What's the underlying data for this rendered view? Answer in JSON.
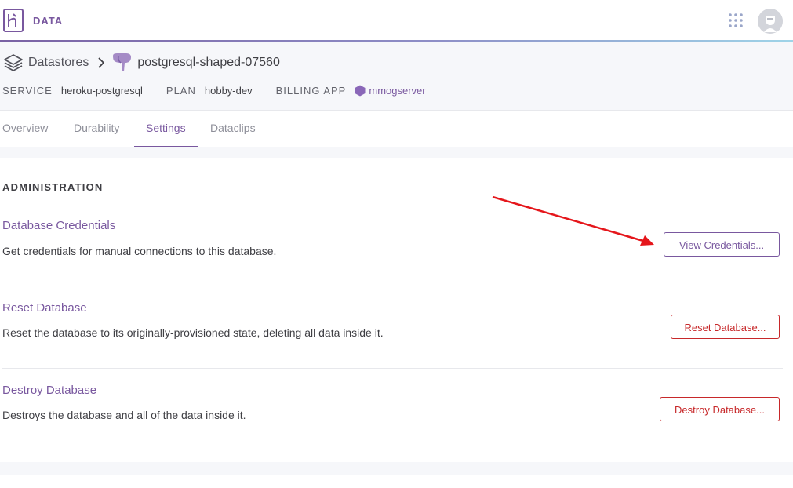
{
  "brand": {
    "label": "DATA",
    "color": "#79589f"
  },
  "icons": {
    "logo": "heroku-logo-icon",
    "apps": "apps-grid-icon",
    "avatar": "user-avatar-icon",
    "datastores": "layers-icon",
    "chevron": "chevron-right-icon",
    "postgres": "postgres-elephant-icon",
    "app": "hexagon-app-icon"
  },
  "breadcrumb": {
    "datastores_label": "Datastores",
    "database_name": "postgresql-shaped-07560"
  },
  "meta": {
    "service_key": "SERVICE",
    "service_value": "heroku-postgresql",
    "plan_key": "PLAN",
    "plan_value": "hobby-dev",
    "billing_key": "BILLING APP",
    "billing_value": "mmogserver"
  },
  "tabs": [
    {
      "label": "Overview",
      "active": false
    },
    {
      "label": "Durability",
      "active": false
    },
    {
      "label": "Settings",
      "active": true
    },
    {
      "label": "Dataclips",
      "active": false
    }
  ],
  "administration": {
    "heading": "ADMINISTRATION",
    "sections": [
      {
        "title": "Database Credentials",
        "description": "Get credentials for manual connections to this database.",
        "button": "View Credentials..."
      },
      {
        "title": "Reset Database",
        "description": "Reset the database to its originally-provisioned state, deleting all data inside it.",
        "button": "Reset Database..."
      },
      {
        "title": "Destroy Database",
        "description": "Destroys the database and all of the data inside it.",
        "button": "Destroy Database..."
      }
    ]
  },
  "colors": {
    "accent": "#79589f",
    "danger": "#c7282a",
    "annotation_arrow": "#e5161b"
  }
}
